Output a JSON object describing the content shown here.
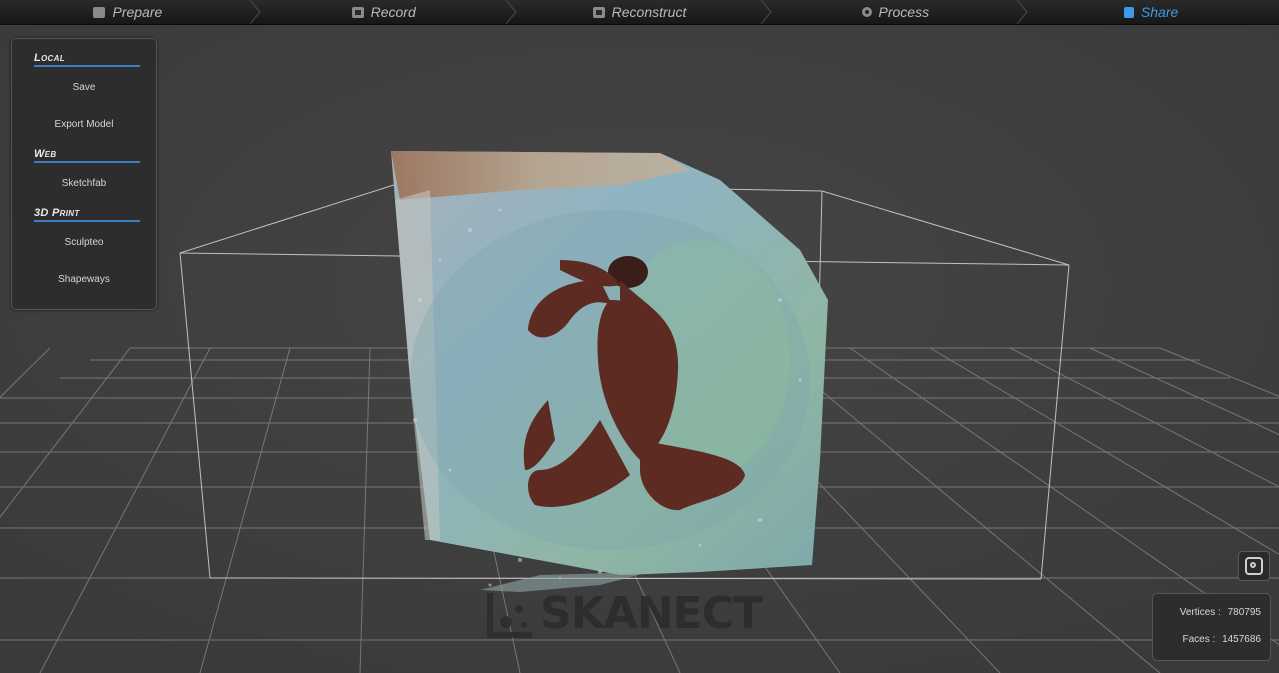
{
  "workflow": {
    "steps": [
      {
        "label": "Prepare",
        "icon": "prepare-icon"
      },
      {
        "label": "Record",
        "icon": "film-icon"
      },
      {
        "label": "Reconstruct",
        "icon": "film-icon"
      },
      {
        "label": "Process",
        "icon": "gear-icon"
      },
      {
        "label": "Share",
        "icon": "thumbs-up-icon"
      }
    ],
    "active_index": 4,
    "active_color": "#3d9ae8"
  },
  "sidebar": {
    "sections": [
      {
        "title": "Local",
        "items": [
          "Save",
          "Export Model"
        ]
      },
      {
        "title": "Web",
        "items": [
          "Sketchfab"
        ]
      },
      {
        "title": "3D Print",
        "items": [
          "Sculpteo",
          "Shapeways"
        ]
      }
    ]
  },
  "logo": {
    "text": "SKANECT"
  },
  "stats": {
    "vertices_label": "Vertices :",
    "vertices_value": "780795",
    "faces_label": "Faces :",
    "faces_value": "1457686"
  },
  "toolbar": {
    "snapshot_icon": "camera-icon"
  }
}
